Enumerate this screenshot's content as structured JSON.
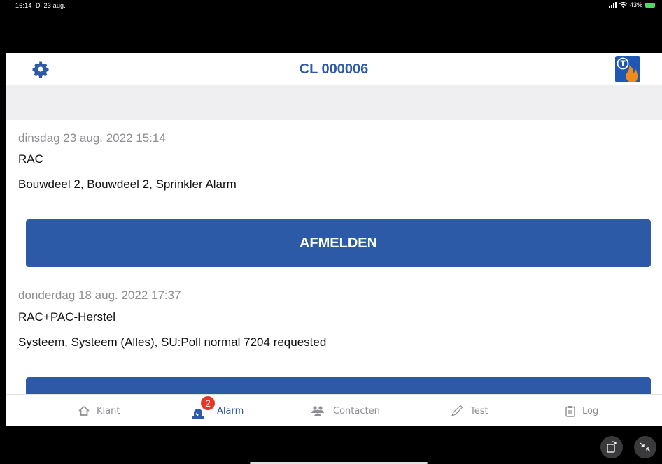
{
  "status_bar": {
    "time": "16:14",
    "date": "Di 23 aug.",
    "battery": "43%"
  },
  "header": {
    "title": "CL 000006"
  },
  "alarms": [
    {
      "date": "dinsdag 23 aug. 2022 15:14",
      "type": "RAC",
      "description": "Bouwdeel 2, Bouwdeel 2, Sprinkler Alarm",
      "button_label": "AFMELDEN"
    },
    {
      "date": "donderdag 18 aug. 2022 17:37",
      "type": "RAC+PAC-Herstel",
      "description": "Systeem, Systeem (Alles), SU:Poll normal 7204 requested",
      "button_label": ""
    }
  ],
  "tabs": [
    {
      "label": "Klant",
      "icon": "home-icon",
      "active": false
    },
    {
      "label": "Alarm",
      "icon": "alarm-icon",
      "active": true,
      "badge": "2"
    },
    {
      "label": "Contacten",
      "icon": "contacts-icon",
      "active": false
    },
    {
      "label": "Test",
      "icon": "pencil-icon",
      "active": false
    },
    {
      "label": "Log",
      "icon": "clipboard-icon",
      "active": false
    }
  ],
  "colors": {
    "primary": "#2d5aa6",
    "badge": "#e6352b",
    "background": "#efeff1"
  }
}
